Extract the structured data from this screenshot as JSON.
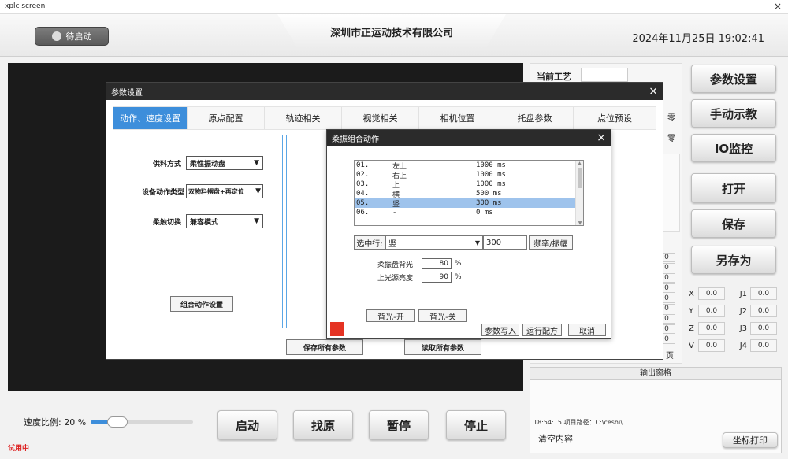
{
  "window": {
    "title": "xplc screen",
    "close_glyph": "×"
  },
  "header": {
    "status_label": "待启动",
    "company": "深圳市正运动技术有限公司",
    "datetime": "2024年11月25日  19:02:41"
  },
  "right_buttons": [
    "参数设置",
    "手动示教",
    "IO监控",
    "打开",
    "保存",
    "另存为"
  ],
  "current_process": {
    "label": "当前工艺",
    "value": ""
  },
  "side_partials": {
    "p1": "零",
    "p2": "零",
    "p3": "页",
    "zeros": [
      "0",
      "0",
      "0",
      "0",
      "0",
      "0",
      "0",
      "0",
      "0"
    ]
  },
  "coords": [
    {
      "a": "X",
      "av": "0.0",
      "b": "J1",
      "bv": "0.0"
    },
    {
      "a": "Y",
      "av": "0.0",
      "b": "J2",
      "bv": "0.0"
    },
    {
      "a": "Z",
      "av": "0.0",
      "b": "J3",
      "bv": "0.0"
    },
    {
      "a": "V",
      "av": "0.0",
      "b": "J4",
      "bv": "0.0"
    }
  ],
  "output": {
    "title": "输出窗格",
    "log": "18:54:15 项目路径：C:\\ceshi\\",
    "clear_label": "清空内容",
    "print_label": "坐标打印"
  },
  "bottom": {
    "speed_label": "速度比例:  20 %",
    "speed_value": 20,
    "buttons": [
      "启动",
      "找原",
      "暂停",
      "停止"
    ],
    "trial": "试用中"
  },
  "param_dialog": {
    "title": "参数设置",
    "close_glyph": "×",
    "tabs": [
      "动作、速度设置",
      "原点配置",
      "轨迹相关",
      "视觉相关",
      "相机位置",
      "托盘参数",
      "点位预设"
    ],
    "active_tab": 0,
    "fields": [
      {
        "label": "供料方式",
        "value": "柔性振动盘"
      },
      {
        "label": "设备动作类型",
        "value": "双物料摆盘+再定位"
      },
      {
        "label": "柔触切换",
        "value": "兼容模式"
      }
    ],
    "combo_button": "组合动作设置",
    "save_all": "保存所有参数",
    "read_all": "读取所有参数"
  },
  "vib_dialog": {
    "title": "柔振组合动作",
    "close_glyph": "×",
    "rows": [
      {
        "idx": "01.",
        "name": "左上",
        "val": "1000 ms"
      },
      {
        "idx": "02.",
        "name": "右上",
        "val": "1000 ms"
      },
      {
        "idx": "03.",
        "name": "上",
        "val": "1000 ms"
      },
      {
        "idx": "04.",
        "name": "横",
        "val": "500 ms"
      },
      {
        "idx": "05.",
        "name": "竖",
        "val": "300 ms"
      },
      {
        "idx": "06.",
        "name": "-",
        "val": "0 ms"
      }
    ],
    "selected_index": 4,
    "select_label": "选中行:",
    "select_value": "竖",
    "duration_value": "300",
    "freq_button": "频率/振幅",
    "backlight_label": "柔振盘背光",
    "backlight_value": "80",
    "top_light_label": "上光源亮度",
    "top_light_value": "90",
    "percent": "%",
    "backlight_on": "背光-开",
    "backlight_off": "背光-关",
    "write_params": "参数写入",
    "run_recipe": "运行配方",
    "cancel": "取消",
    "indicator_color": "#e53323"
  },
  "colors": {
    "accent": "#3d8edb",
    "highlight": "#9ec3ec",
    "dark": "#1b1b1b"
  }
}
